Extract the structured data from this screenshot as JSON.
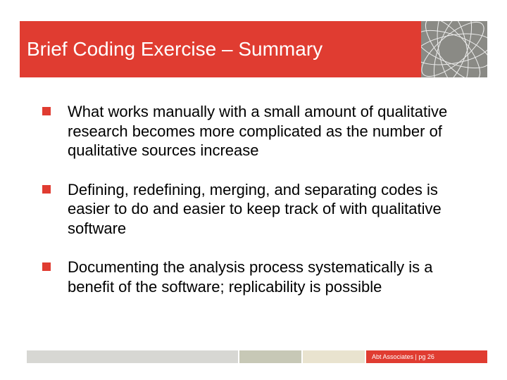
{
  "header": {
    "title": "Brief Coding Exercise – Summary"
  },
  "bullets": [
    {
      "text": "What works manually with a small amount of qualitative research becomes more complicated as the number of qualitative sources increase"
    },
    {
      "text": "Defining, redefining, merging, and separating codes is easier to do and easier to keep track of with qualitative software"
    },
    {
      "text": "Documenting the analysis process systematically is a benefit of the software; replicability is possible"
    }
  ],
  "footer": {
    "attribution": "Abt Associates | pg 26"
  },
  "colors": {
    "accent": "#e03c31",
    "logo_bg": "#8a8a85"
  }
}
